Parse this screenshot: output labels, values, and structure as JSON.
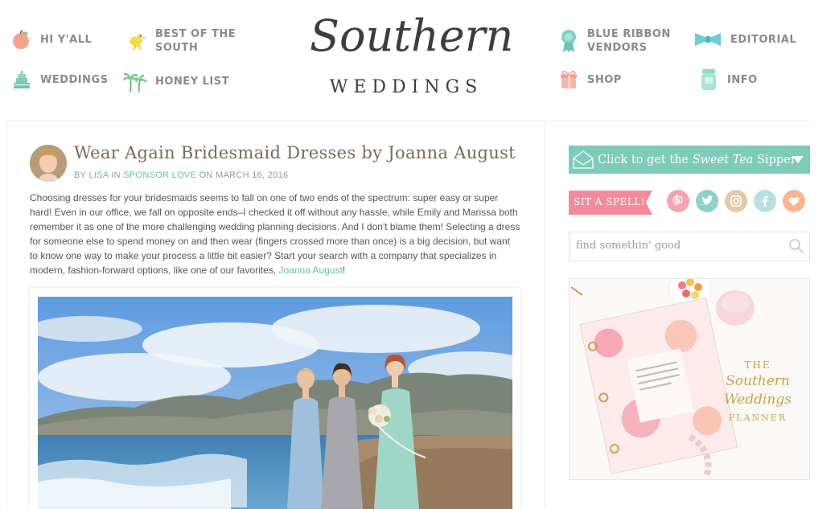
{
  "nav": {
    "hi_yall": "HI Y'ALL",
    "best_of_south": "BEST OF THE\nSOUTH",
    "weddings": "WEDDINGS",
    "honey_list": "HONEY LIST",
    "blue_ribbon": "BLUE RIBBON\nVENDORS",
    "editorial": "EDITORIAL",
    "shop": "SHOP",
    "info": "INFO"
  },
  "logo": {
    "script": "Southern",
    "sub": "WEDDINGS"
  },
  "post": {
    "title": "Wear Again Bridesmaid Dresses by Joanna August",
    "by": "BY ",
    "author": "LISA",
    "in": " IN ",
    "category": "SPONSOR LOVE",
    "on": " ON ",
    "date": "MARCH 16, 2016",
    "body": "Choosing dresses for your bridesmaids seems to fall on one of two ends of the spectrum: super easy or super hard! Even in our office, we fall on opposite ends–I checked it off without any hassle, while Emily and Marissa both remember it as one of the more challenging wedding planning decisions. And I don't blame them! Selecting a dress for someone else to spend money on and then wear (fingers crossed more than once) is a big decision, but want to know one way to make your process a little bit easier? Start your search with a company that specializes in modern, fashion-forward options, like one of our favorites, ",
    "body_link": "Joanna August",
    "body_end": "!"
  },
  "sidebar": {
    "cta_prefix": "Click to get the ",
    "cta_script": "Sweet Tea",
    "cta_suffix": " Sipper",
    "sit_spell": "SIT A SPELL!",
    "search_placeholder": "find somethin' good",
    "ad_the": "THE",
    "ad_script_1": "Southern",
    "ad_script_2": "Weddings",
    "ad_planner": "PLANNER"
  },
  "colors": {
    "accent_mint": "#7dcbb8",
    "link": "#6cc0a3",
    "social_pink": "#f2a5b0",
    "social_teal": "#8fd0c9",
    "social_tan": "#e4c9a8",
    "social_blue": "#b8e0e4",
    "social_orange": "#f7b68f"
  },
  "icons": [
    "peach-icon",
    "chicken-icon",
    "cake-icon",
    "palm-trees-icon",
    "ribbon-rosette-icon",
    "bow-tie-icon",
    "gift-box-icon",
    "mason-jar-icon",
    "envelope-icon",
    "chevron-down-icon",
    "pinterest-icon",
    "twitter-icon",
    "instagram-icon",
    "facebook-icon",
    "heart-icon",
    "search-icon"
  ]
}
